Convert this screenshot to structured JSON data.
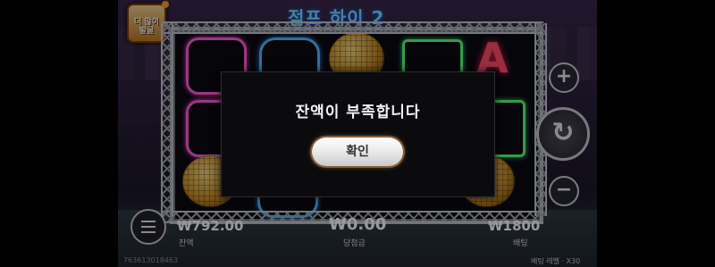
{
  "game": {
    "title": "점프 하이 2"
  },
  "header": {
    "more_games_label": "더 많이\n발굴"
  },
  "footer": {
    "balance_value": "₩792.00",
    "balance_label": "잔액",
    "win_value": "₩0.00",
    "win_label": "당첨금",
    "bet_value": "₩1800",
    "bet_label": "배팅",
    "round_id": "763613018463",
    "bet_info": "배팅 레벨 · X30"
  },
  "controls": {
    "plus_symbol": "+",
    "minus_symbol": "−",
    "spin_symbol": "↻"
  },
  "dialog": {
    "message": "잔액이 부족합니다",
    "confirm_label": "확인"
  },
  "colors": {
    "dialog_bg": "#0b0b0e",
    "button_glow": "#c08040",
    "frame": "#b5b9c0"
  }
}
